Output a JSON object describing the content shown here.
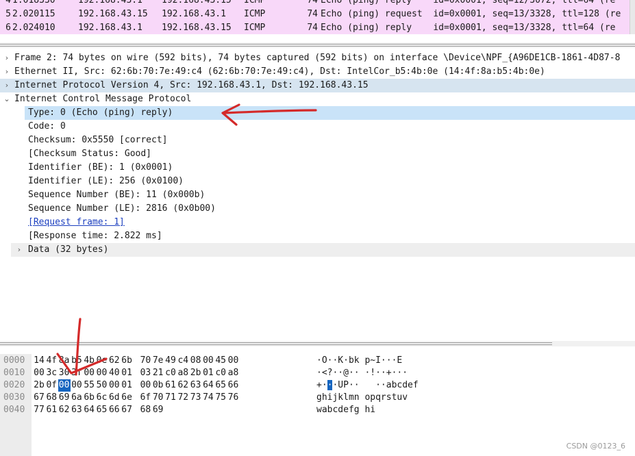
{
  "packet_list": {
    "rows": [
      {
        "no": "4",
        "time": "1.018330",
        "src": "192.168.43.1",
        "dst": "192.168.43.15",
        "proto": "ICMP",
        "len": "74",
        "info": "Echo (ping) reply    id=0x0001, seq=12/3072, ttl=64 (re"
      },
      {
        "no": "5",
        "time": "2.020115",
        "src": "192.168.43.15",
        "dst": "192.168.43.1",
        "proto": "ICMP",
        "len": "74",
        "info": "Echo (ping) request  id=0x0001, seq=13/3328, ttl=128 (re"
      },
      {
        "no": "6",
        "time": "2.024010",
        "src": "192.168.43.1",
        "dst": "192.168.43.15",
        "proto": "ICMP",
        "len": "74",
        "info": "Echo (ping) reply    id=0x0001, seq=13/3328, ttl=64 (re"
      }
    ]
  },
  "details": {
    "frame": "Frame 2: 74 bytes on wire (592 bits), 74 bytes captured (592 bits) on interface \\Device\\NPF_{A96DE1CB-1861-4D87-8",
    "ethernet": "Ethernet II, Src: 62:6b:70:7e:49:c4 (62:6b:70:7e:49:c4), Dst: IntelCor_b5:4b:0e (14:4f:8a:b5:4b:0e)",
    "ip": "Internet Protocol Version 4, Src: 192.168.43.1, Dst: 192.168.43.15",
    "icmp": "Internet Control Message Protocol",
    "icmp_fields": {
      "type": "Type: 0 (Echo (ping) reply)",
      "code": "Code: 0",
      "checksum": "Checksum: 0x5550 [correct]",
      "checksum_status": "[Checksum Status: Good]",
      "identifier_be": "Identifier (BE): 1 (0x0001)",
      "identifier_le": "Identifier (LE): 256 (0x0100)",
      "seq_be": "Sequence Number (BE): 11 (0x000b)",
      "seq_le": "Sequence Number (LE): 2816 (0x0b00)",
      "request_frame": "[Request frame: 1]",
      "response_time": "[Response time: 2.822 ms]",
      "data": "Data (32 bytes)"
    }
  },
  "bytes": {
    "rows": [
      {
        "offset": "0000",
        "hex": [
          "14",
          "4f",
          "8a",
          "b5",
          "4b",
          "0e",
          "62",
          "6b",
          "70",
          "7e",
          "49",
          "c4",
          "08",
          "00",
          "45",
          "00"
        ],
        "ascii_a": "·O··K·bk",
        "ascii_sel": "",
        "ascii_b": " p~I···E"
      },
      {
        "offset": "0010",
        "hex": [
          "00",
          "3c",
          "30",
          "3f",
          "00",
          "00",
          "40",
          "01",
          "03",
          "21",
          "c0",
          "a8",
          "2b",
          "01",
          "c0",
          "a8"
        ],
        "ascii_a": "·<?··@··",
        "ascii_sel": "",
        "ascii_b": " ·!··+···"
      },
      {
        "offset": "0020",
        "hex": [
          "2b",
          "0f",
          "00",
          "00",
          "55",
          "50",
          "00",
          "01",
          "00",
          "0b",
          "61",
          "62",
          "63",
          "64",
          "65",
          "66"
        ],
        "ascii_a": "+·",
        "ascii_sel": "·",
        "ascii_b": "·UP··   ··abcdef"
      },
      {
        "offset": "0030",
        "hex": [
          "67",
          "68",
          "69",
          "6a",
          "6b",
          "6c",
          "6d",
          "6e",
          "6f",
          "70",
          "71",
          "72",
          "73",
          "74",
          "75",
          "76"
        ],
        "ascii_a": "ghijklmn",
        "ascii_sel": "",
        "ascii_b": " opqrstuv"
      },
      {
        "offset": "0040",
        "hex": [
          "77",
          "61",
          "62",
          "63",
          "64",
          "65",
          "66",
          "67",
          "68",
          "69"
        ],
        "ascii_a": "wabcdefg",
        "ascii_sel": "",
        "ascii_b": " hi"
      }
    ],
    "selected_row": 2,
    "selected_col": 2
  },
  "colors": {
    "packet_row": "#f8d8f9",
    "selection": "#c9e3f8",
    "byte_selection": "#1565c0",
    "annotation": "#d42a2a"
  },
  "watermark": "CSDN @0123_6"
}
